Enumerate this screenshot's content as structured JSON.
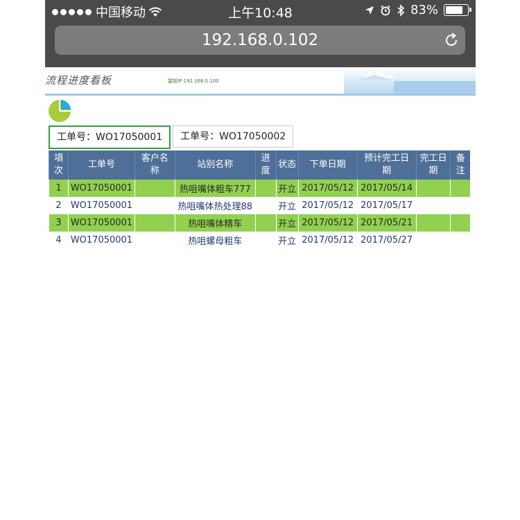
{
  "status_bar": {
    "carrier": "中国移动",
    "time": "上午10:48",
    "battery": "83%",
    "battery_level": 0.83
  },
  "browser": {
    "url": "192.168.0.102"
  },
  "header": {
    "title": "流程进度看板",
    "ip_text": "當前IP 192.168.0.100"
  },
  "colors": {
    "accent_green": "#92d050",
    "header_blue": "#4e6f98",
    "tab_active_border": "#2ea43a",
    "pie_blue": "#29a9e1",
    "pie_green": "#a8cc3a"
  },
  "tabs": [
    {
      "label": "工单号：WO17050001",
      "active": true
    },
    {
      "label": "工单号：WO17050002",
      "active": false
    }
  ],
  "table": {
    "headers": {
      "seq_1": "項",
      "seq_2": "次",
      "wo": "工单号",
      "cust_1": "客户名",
      "cust_2": "称",
      "station": "站别名称",
      "prog_1": "进",
      "prog_2": "度",
      "status": "状态",
      "order_date": "下单日期",
      "plan_1": "预计完工日",
      "plan_2": "期",
      "done_1": "完工日",
      "done_2": "期",
      "note_1": "备",
      "note_2": "注"
    },
    "rows": [
      {
        "seq": "1",
        "wo": "WO17050001",
        "customer": "",
        "station": "热咀嘴体粗车777",
        "progress": "",
        "status": "开立",
        "order_date": "2017/05/12",
        "plan_date": "2017/05/14",
        "done_date": "",
        "note": ""
      },
      {
        "seq": "2",
        "wo": "WO17050001",
        "customer": "",
        "station": "热咀嘴体热处理88",
        "progress": "",
        "status": "开立",
        "order_date": "2017/05/12",
        "plan_date": "2017/05/17",
        "done_date": "",
        "note": ""
      },
      {
        "seq": "3",
        "wo": "WO17050001",
        "customer": "",
        "station": "热咀嘴体精车",
        "progress": "",
        "status": "开立",
        "order_date": "2017/05/12",
        "plan_date": "2017/05/21",
        "done_date": "",
        "note": ""
      },
      {
        "seq": "4",
        "wo": "WO17050001",
        "customer": "",
        "station": "热咀螺母粗车",
        "progress": "",
        "status": "开立",
        "order_date": "2017/05/12",
        "plan_date": "2017/05/27",
        "done_date": "",
        "note": ""
      }
    ]
  }
}
